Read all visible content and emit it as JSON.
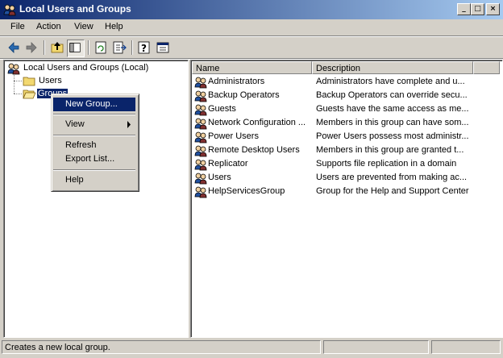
{
  "window": {
    "title": "Local Users and Groups"
  },
  "title_buttons": {
    "minimize": "_",
    "maximize": "□",
    "close": "×"
  },
  "menubar": {
    "items": [
      "File",
      "Action",
      "View",
      "Help"
    ]
  },
  "toolbar": {
    "icons": [
      "back-arrow-icon",
      "forward-arrow-icon",
      "up-folder-icon",
      "show-hide-tree-icon",
      "refresh-icon",
      "export-list-icon",
      "help-icon",
      "properties-icon"
    ]
  },
  "tree": {
    "root": "Local Users and Groups (Local)",
    "users": "Users",
    "groups": "Groups"
  },
  "context_menu": {
    "new_group": "New Group...",
    "view": "View",
    "refresh": "Refresh",
    "export_list": "Export List...",
    "help": "Help"
  },
  "list": {
    "columns": [
      "Name",
      "Description"
    ],
    "rows": [
      {
        "name": "Administrators",
        "description": "Administrators have complete and u..."
      },
      {
        "name": "Backup Operators",
        "description": "Backup Operators can override secu..."
      },
      {
        "name": "Guests",
        "description": "Guests have the same access as me..."
      },
      {
        "name": "Network Configuration ...",
        "description": "Members in this group can have som..."
      },
      {
        "name": "Power Users",
        "description": "Power Users possess most administr..."
      },
      {
        "name": "Remote Desktop Users",
        "description": "Members in this group are granted t..."
      },
      {
        "name": "Replicator",
        "description": "Supports file replication in a domain"
      },
      {
        "name": "Users",
        "description": "Users are prevented from making ac..."
      },
      {
        "name": "HelpServicesGroup",
        "description": "Group for the Help and Support Center"
      }
    ]
  },
  "status": {
    "text": "Creates a new local group."
  },
  "colors": {
    "title_start": "#0a246a",
    "title_end": "#a6caf0",
    "selection": "#0a246a",
    "face": "#d4d0c8"
  }
}
